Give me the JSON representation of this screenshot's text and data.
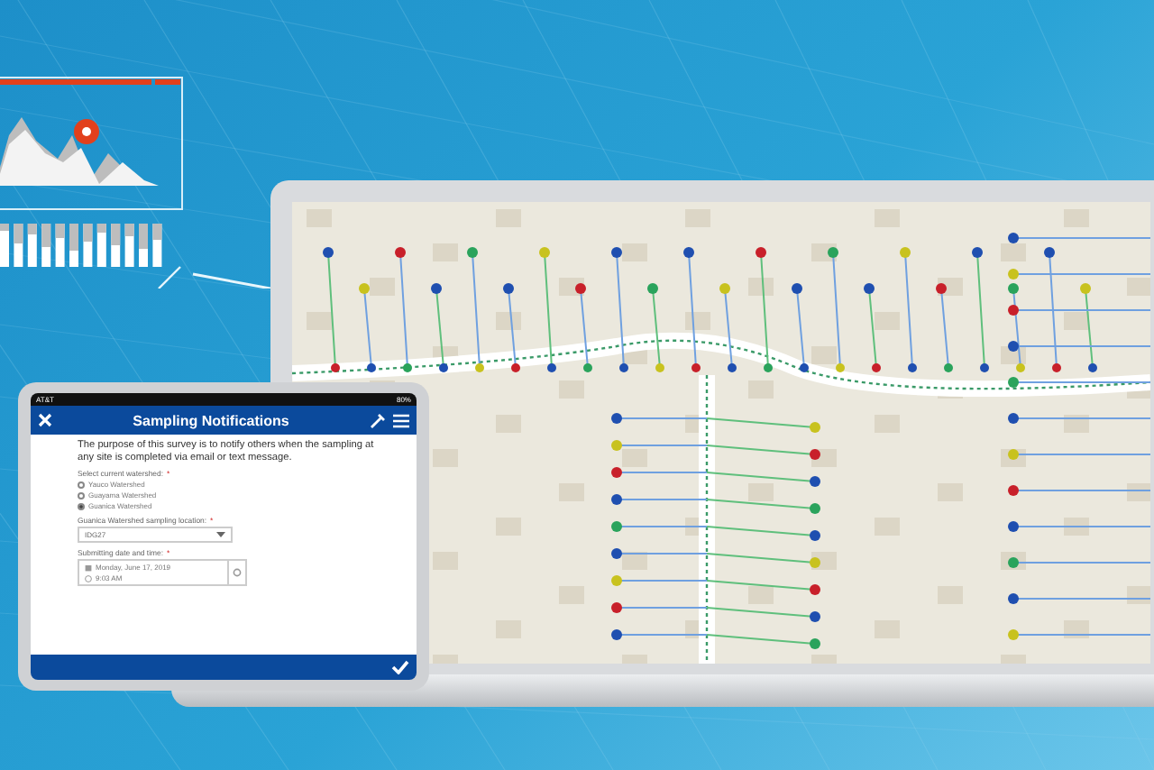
{
  "tablet": {
    "status_bar": {
      "carrier": "AT&T",
      "battery": "80%"
    },
    "header": {
      "title": "Sampling Notifications"
    },
    "intro": "The purpose of this survey is to notify others when the sampling at any site is completed via email or text message.",
    "questions": [
      {
        "kind": "radio",
        "label": "Select current watershed:",
        "required_mark": "*",
        "options": [
          {
            "label": "Yauco Watershed",
            "selected": false
          },
          {
            "label": "Guayama Watershed",
            "selected": false
          },
          {
            "label": "Guanica Watershed",
            "selected": true
          }
        ]
      },
      {
        "kind": "dropdown",
        "label": "Guanica Watershed sampling location:",
        "required_mark": "*",
        "value": "IDG27"
      },
      {
        "kind": "datetime",
        "label": "Submitting date and time:",
        "required_mark": "*",
        "date": "Monday, June 17, 2019",
        "time": "9:03 AM"
      }
    ]
  }
}
